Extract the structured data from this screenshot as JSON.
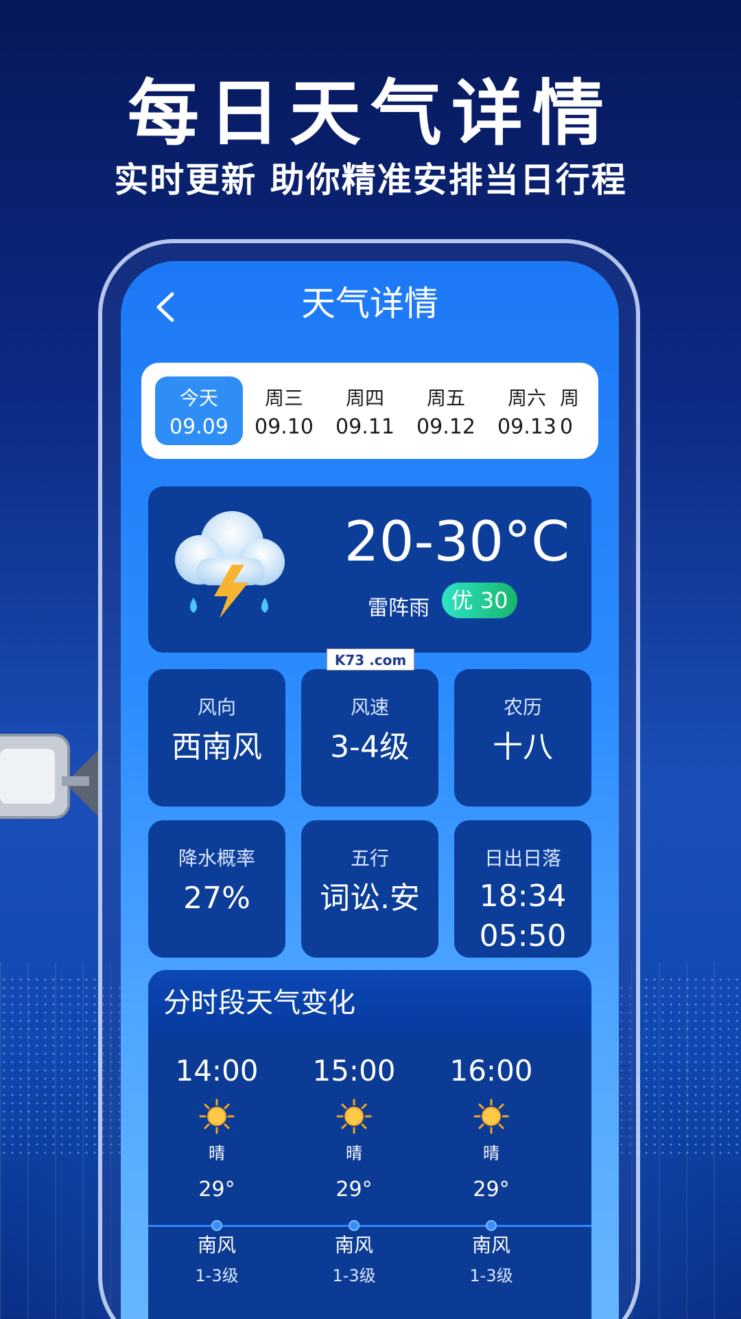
{
  "hero": {
    "title": "每日天气详情",
    "subtitle": "实时更新 助你精准安排当日行程"
  },
  "screen": {
    "title": "天气详情",
    "back_icon": "chevron-left-icon"
  },
  "dates": [
    {
      "name": "今天",
      "date": "09.09",
      "active": true
    },
    {
      "name": "周三",
      "date": "09.10",
      "active": false
    },
    {
      "name": "周四",
      "date": "09.11",
      "active": false
    },
    {
      "name": "周五",
      "date": "09.12",
      "active": false
    },
    {
      "name": "周六",
      "date": "09.13",
      "active": false
    },
    {
      "name": "周",
      "date": "0",
      "active": false
    }
  ],
  "today": {
    "temp_range": "20-30°C",
    "condition": "雷阵雨",
    "aqi": "优 30",
    "icon": "thunderstorm-cloud-icon"
  },
  "info": [
    {
      "label": "风向",
      "value": "西南风"
    },
    {
      "label": "风速",
      "value": "3-4级"
    },
    {
      "label": "农历",
      "value": "十八"
    },
    {
      "label": "降水概率",
      "value": "27%"
    },
    {
      "label": "五行",
      "value": "词讼.安"
    },
    {
      "label": "日出日落",
      "value": "18:34",
      "value2": "05:50"
    }
  ],
  "hourly": {
    "title": "分时段天气变化",
    "items": [
      {
        "time": "14:00",
        "cond": "晴",
        "temp": "29°",
        "wind": "南风",
        "level": "1-3级"
      },
      {
        "time": "15:00",
        "cond": "晴",
        "temp": "29°",
        "wind": "南风",
        "level": "1-3级"
      },
      {
        "time": "16:00",
        "cond": "晴",
        "temp": "29°",
        "wind": "南风",
        "level": "1-3级"
      }
    ]
  },
  "watermark": "K73 .com",
  "colors": {
    "accent": "#2e8ef5",
    "card": "#0b3d99",
    "aqi_good": "#17b66c"
  }
}
